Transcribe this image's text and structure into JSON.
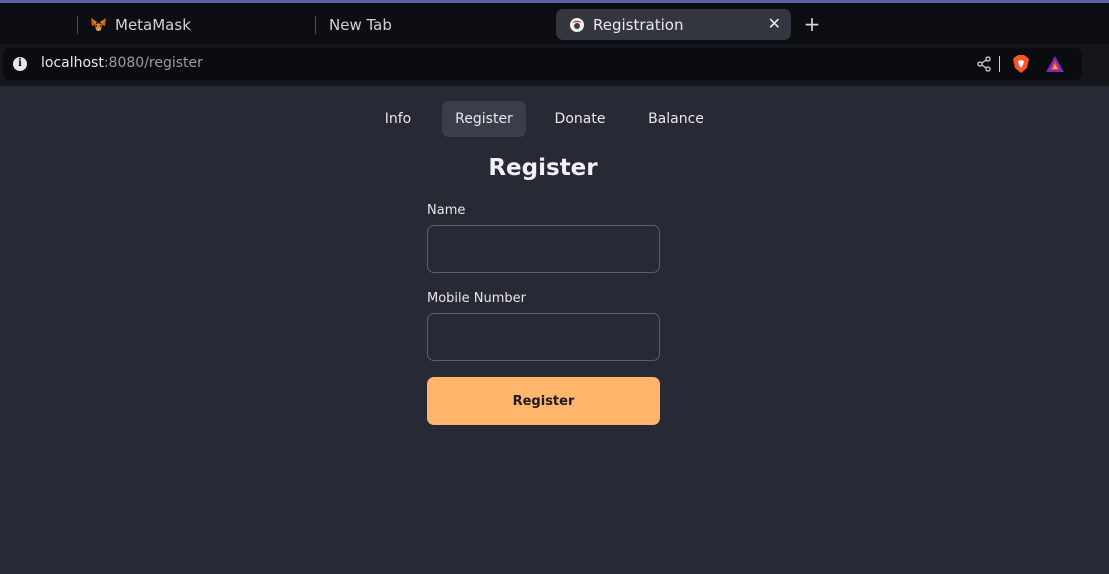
{
  "browser": {
    "tabs": [
      {
        "label": "MetaMask",
        "favicon": "metamask-fox-icon",
        "active": false
      },
      {
        "label": "New Tab",
        "favicon": "",
        "active": false
      },
      {
        "label": "Registration",
        "favicon": "page-favicon-icon",
        "active": true
      }
    ],
    "close_glyph": "✕",
    "new_tab_glyph": "+",
    "url_host": "localhost",
    "url_rest": ":8080/register",
    "icons": [
      "info-icon",
      "share-icon",
      "brave-shield-icon",
      "brave-rewards-icon"
    ]
  },
  "nav": {
    "items": [
      {
        "label": "Info",
        "active": false
      },
      {
        "label": "Register",
        "active": true
      },
      {
        "label": "Donate",
        "active": false
      },
      {
        "label": "Balance",
        "active": false
      }
    ]
  },
  "form": {
    "title": "Register",
    "name_label": "Name",
    "name_value": "",
    "mobile_label": "Mobile Number",
    "mobile_value": "",
    "submit_label": "Register"
  },
  "colors": {
    "page_background": "#272935",
    "accent_button": "#ffb56b",
    "active_nav": "#3a3d4a"
  }
}
